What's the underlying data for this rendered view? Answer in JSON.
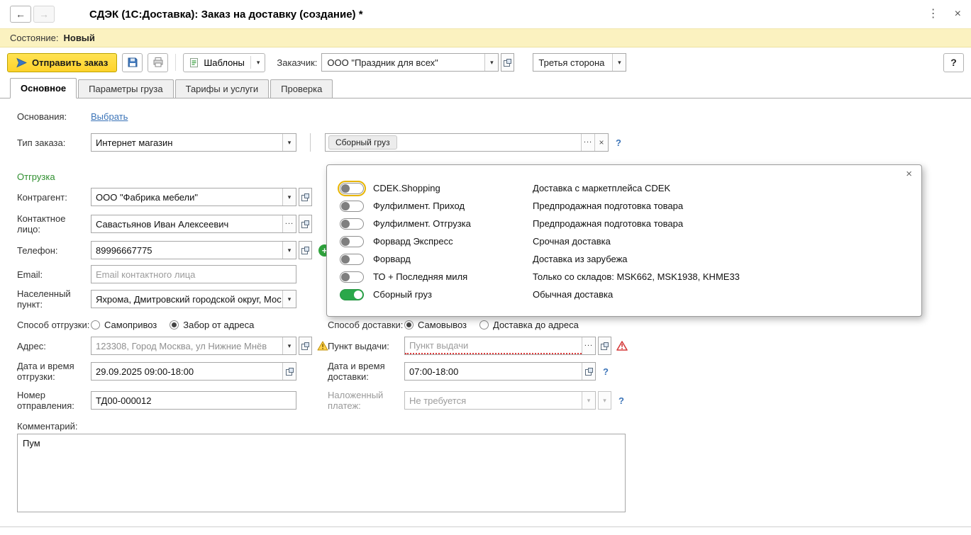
{
  "icons": {
    "back": "←",
    "forward": "→",
    "menu": "⋮",
    "close": "×",
    "dropdown": "▾",
    "ellipsis": "...",
    "help": "?",
    "plus": "+"
  },
  "titlebar": {
    "title": "СДЭК (1С:Доставка): Заказ на доставку (создание) *"
  },
  "statusbar": {
    "label": "Состояние:",
    "value": "Новый"
  },
  "toolbar": {
    "send": "Отправить заказ",
    "templates": "Шаблоны",
    "customer_label": "Заказчик:",
    "customer_value": "ООО \"Праздник для всех\"",
    "payer": "Третья сторона"
  },
  "tabs": {
    "items": [
      {
        "label": "Основное"
      },
      {
        "label": "Параметры груза"
      },
      {
        "label": "Тарифы и услуги"
      },
      {
        "label": "Проверка"
      }
    ]
  },
  "form": {
    "basis": {
      "label": "Основания:",
      "link": "Выбрать"
    },
    "order_type": {
      "label": "Тип заказа:",
      "value": "Интернет магазин"
    },
    "tariff_field": {
      "tag": "Сборный груз"
    },
    "shipment_header": "Отгрузка",
    "counterparty": {
      "label": "Контрагент:",
      "value": "ООО \"Фабрика мебели\""
    },
    "contact": {
      "label": "Контактное лицо:",
      "value": "Савастьянов Иван Алексеевич"
    },
    "phone": {
      "label": "Телефон:",
      "value": "89996667775"
    },
    "email": {
      "label": "Email:",
      "placeholder": "Email контактного лица"
    },
    "city": {
      "label": "Населенный пункт:",
      "value": "Яхрома, Дмитровский городской округ, Мос"
    },
    "ship_method": {
      "label": "Способ отгрузки:",
      "options": [
        {
          "label": "Самопривоз",
          "checked": false
        },
        {
          "label": "Забор от адреса",
          "checked": true
        }
      ]
    },
    "address": {
      "label": "Адрес:",
      "value": "123308, Город Москва, ул Нижние Мнёв"
    },
    "ship_datetime": {
      "label": "Дата и время отгрузки:",
      "value": "29.09.2025 09:00-18:00"
    },
    "shipment_number": {
      "label": "Номер отправления:",
      "value": "ТД00-000012"
    },
    "comment": {
      "label": "Комментарий:",
      "value": "Пум"
    },
    "delivery_method": {
      "label": "Способ доставки:",
      "options": [
        {
          "label": "Самовывоз",
          "checked": true
        },
        {
          "label": "Доставка до адреса",
          "checked": false
        }
      ]
    },
    "pickup_point": {
      "label": "Пункт выдачи:",
      "placeholder": "Пункт выдачи"
    },
    "delivery_datetime": {
      "label": "Дата и время доставки:",
      "value": "07:00-18:00"
    },
    "cod": {
      "label": "Наложенный платеж:",
      "value": "Не требуется"
    }
  },
  "tariff_popup": {
    "items": [
      {
        "name": "CDEK.Shopping",
        "desc": "Доставка с маркетплейса CDEK",
        "on": false,
        "focused": true
      },
      {
        "name": "Фулфилмент. Приход",
        "desc": "Предпродажная подготовка товара",
        "on": false
      },
      {
        "name": "Фулфилмент. Отгрузка",
        "desc": "Предпродажная подготовка товара",
        "on": false
      },
      {
        "name": "Форвард Экспресс",
        "desc": "Срочная доставка",
        "on": false
      },
      {
        "name": "Форвард",
        "desc": "Доставка из зарубежа",
        "on": false
      },
      {
        "name": "ТО + Последняя миля",
        "desc": "Только со складов: MSK662, MSK1938, KHME33",
        "on": false
      },
      {
        "name": "Сборный груз",
        "desc": "Обычная доставка",
        "on": true
      }
    ]
  }
}
